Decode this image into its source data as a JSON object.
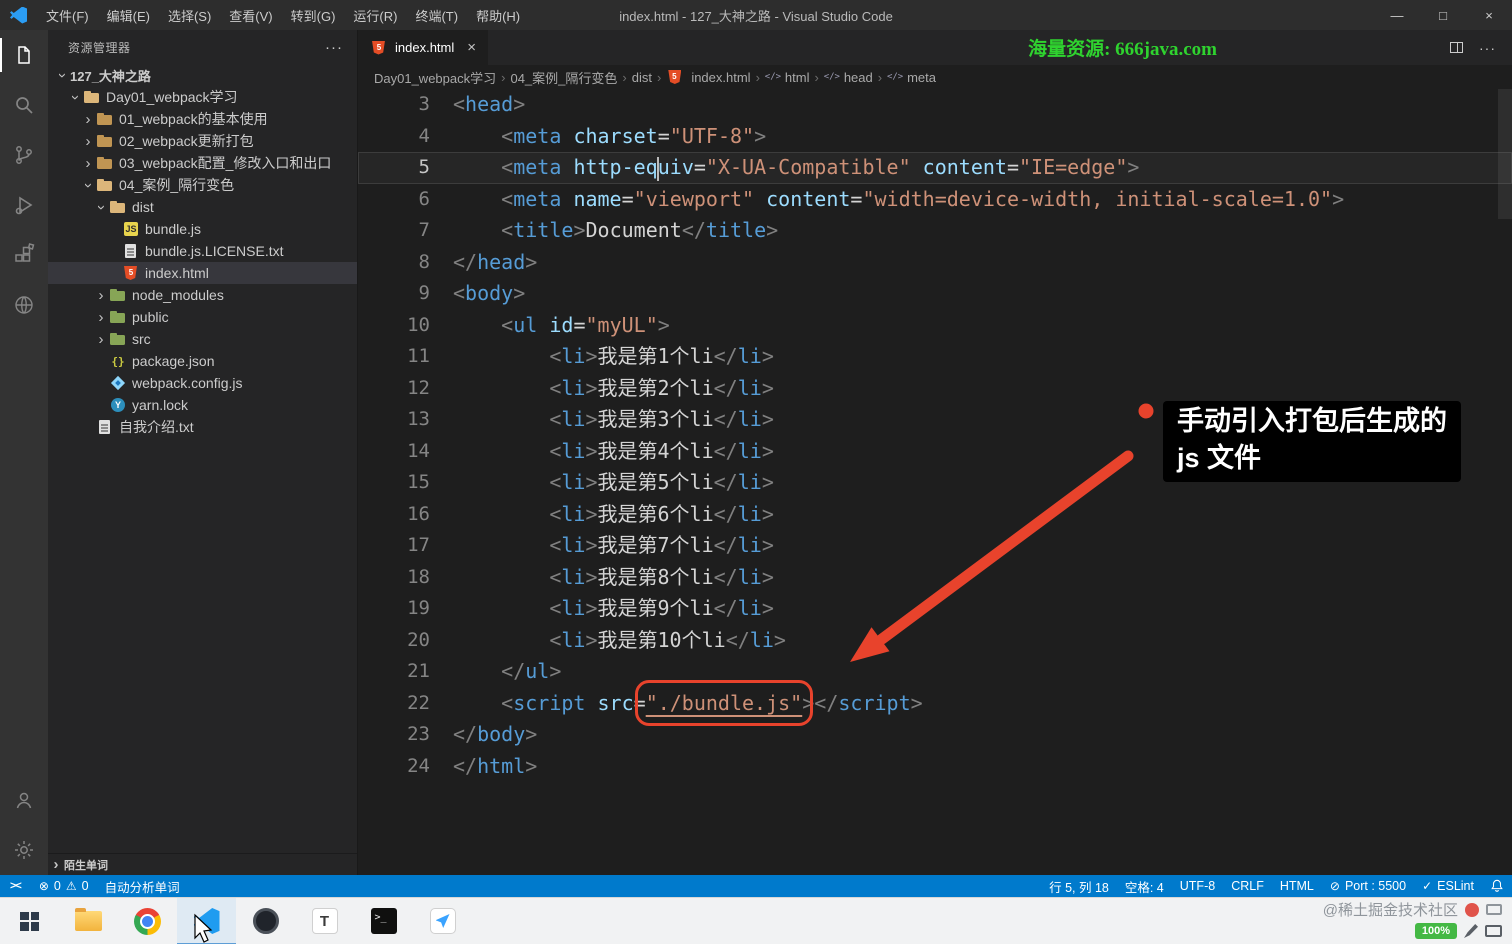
{
  "window": {
    "title": "index.html - 127_大神之路 - Visual Studio Code",
    "menus": [
      "文件(F)",
      "编辑(E)",
      "选择(S)",
      "查看(V)",
      "转到(G)",
      "运行(R)",
      "终端(T)",
      "帮助(H)"
    ],
    "controls": [
      "—",
      "□",
      "×"
    ]
  },
  "sidebar": {
    "title": "资源管理器",
    "more": "···",
    "bottom_section": "陌生单词",
    "tree": [
      {
        "label": "127_大神之路",
        "lvl": 0,
        "chev": "down"
      },
      {
        "label": "Day01_webpack学习",
        "lvl": 1,
        "chev": "down",
        "icon": "folder-open"
      },
      {
        "label": "01_webpack的基本使用",
        "lvl": 2,
        "chev": "right",
        "icon": "folder"
      },
      {
        "label": "02_webpack更新打包",
        "lvl": 2,
        "chev": "right",
        "icon": "folder"
      },
      {
        "label": "03_webpack配置_修改入口和出口",
        "lvl": 2,
        "chev": "right",
        "icon": "folder"
      },
      {
        "label": "04_案例_隔行变色",
        "lvl": 2,
        "chev": "down",
        "icon": "folder-open"
      },
      {
        "label": "dist",
        "lvl": 3,
        "chev": "down",
        "icon": "folder-open"
      },
      {
        "label": "bundle.js",
        "lvl": 4,
        "icon": "js"
      },
      {
        "label": "bundle.js.LICENSE.txt",
        "lvl": 4,
        "icon": "txt"
      },
      {
        "label": "index.html",
        "lvl": 4,
        "icon": "html",
        "selected": true
      },
      {
        "label": "node_modules",
        "lvl": 3,
        "chev": "right",
        "icon": "folder-green"
      },
      {
        "label": "public",
        "lvl": 3,
        "chev": "right",
        "icon": "folder-green"
      },
      {
        "label": "src",
        "lvl": 3,
        "chev": "right",
        "icon": "folder-green"
      },
      {
        "label": "package.json",
        "lvl": 3,
        "icon": "json"
      },
      {
        "label": "webpack.config.js",
        "lvl": 3,
        "icon": "webpack"
      },
      {
        "label": "yarn.lock",
        "lvl": 3,
        "icon": "yarn"
      },
      {
        "label": "自我介绍.txt",
        "lvl": 2,
        "icon": "txt"
      }
    ]
  },
  "editor": {
    "tab": {
      "label": "index.html",
      "close": "×"
    },
    "promo": "海量资源: 666java.com",
    "more_dots": "···",
    "breadcrumb_sep": "›",
    "breadcrumbs": [
      {
        "label": "Day01_webpack学习"
      },
      {
        "label": "04_案例_隔行变色"
      },
      {
        "label": "dist"
      },
      {
        "label": "index.html",
        "icon": "html"
      },
      {
        "label": "html",
        "icon": "sym"
      },
      {
        "label": "head",
        "icon": "sym"
      },
      {
        "label": "meta",
        "icon": "sym"
      }
    ],
    "code": {
      "lines": [
        {
          "n": 3,
          "tok": [
            [
              "<",
              "p"
            ],
            [
              "head",
              "tag"
            ],
            [
              ">",
              "p"
            ]
          ]
        },
        {
          "n": 4,
          "tok": [
            [
              "    ",
              "txt"
            ],
            [
              "<",
              "p"
            ],
            [
              "meta",
              "tag"
            ],
            [
              " ",
              "txt"
            ],
            [
              "charset",
              "attr"
            ],
            [
              "=",
              "txt"
            ],
            [
              "\"UTF-8\"",
              "str"
            ],
            [
              ">",
              "p"
            ]
          ]
        },
        {
          "n": 5,
          "cur": true,
          "tok": [
            [
              "    ",
              "txt"
            ],
            [
              "<",
              "p"
            ],
            [
              "meta",
              "tag"
            ],
            [
              " ",
              "txt"
            ],
            [
              "http-eq",
              "attr"
            ],
            [
              "",
              "cursor"
            ],
            [
              "uiv",
              "attr"
            ],
            [
              "=",
              "txt"
            ],
            [
              "\"X-UA-Compatible\"",
              "str"
            ],
            [
              " ",
              "txt"
            ],
            [
              "content",
              "attr"
            ],
            [
              "=",
              "txt"
            ],
            [
              "\"IE=edge\"",
              "str"
            ],
            [
              ">",
              "p"
            ]
          ]
        },
        {
          "n": 6,
          "tok": [
            [
              "    ",
              "txt"
            ],
            [
              "<",
              "p"
            ],
            [
              "meta",
              "tag"
            ],
            [
              " ",
              "txt"
            ],
            [
              "name",
              "attr"
            ],
            [
              "=",
              "txt"
            ],
            [
              "\"viewport\"",
              "str"
            ],
            [
              " ",
              "txt"
            ],
            [
              "content",
              "attr"
            ],
            [
              "=",
              "txt"
            ],
            [
              "\"width=device-width, initial-scale=1.0\"",
              "str"
            ],
            [
              ">",
              "p"
            ]
          ]
        },
        {
          "n": 7,
          "tok": [
            [
              "    ",
              "txt"
            ],
            [
              "<",
              "p"
            ],
            [
              "title",
              "tag"
            ],
            [
              ">",
              "p"
            ],
            [
              "Document",
              "txt"
            ],
            [
              "</",
              "p"
            ],
            [
              "title",
              "tag"
            ],
            [
              ">",
              "p"
            ]
          ]
        },
        {
          "n": 8,
          "tok": [
            [
              "</",
              "p"
            ],
            [
              "head",
              "tag"
            ],
            [
              ">",
              "p"
            ]
          ]
        },
        {
          "n": 9,
          "tok": [
            [
              "<",
              "p"
            ],
            [
              "body",
              "tag"
            ],
            [
              ">",
              "p"
            ]
          ]
        },
        {
          "n": 10,
          "tok": [
            [
              "    ",
              "txt"
            ],
            [
              "<",
              "p"
            ],
            [
              "ul",
              "tag"
            ],
            [
              " ",
              "txt"
            ],
            [
              "id",
              "attr"
            ],
            [
              "=",
              "txt"
            ],
            [
              "\"myUL\"",
              "str"
            ],
            [
              ">",
              "p"
            ]
          ]
        },
        {
          "n": 11,
          "tok": [
            [
              "        ",
              "txt"
            ],
            [
              "<",
              "p"
            ],
            [
              "li",
              "tag"
            ],
            [
              ">",
              "p"
            ],
            [
              "我是第1个li",
              "txt"
            ],
            [
              "</",
              "p"
            ],
            [
              "li",
              "tag"
            ],
            [
              ">",
              "p"
            ]
          ]
        },
        {
          "n": 12,
          "tok": [
            [
              "        ",
              "txt"
            ],
            [
              "<",
              "p"
            ],
            [
              "li",
              "tag"
            ],
            [
              ">",
              "p"
            ],
            [
              "我是第2个li",
              "txt"
            ],
            [
              "</",
              "p"
            ],
            [
              "li",
              "tag"
            ],
            [
              ">",
              "p"
            ]
          ]
        },
        {
          "n": 13,
          "tok": [
            [
              "        ",
              "txt"
            ],
            [
              "<",
              "p"
            ],
            [
              "li",
              "tag"
            ],
            [
              ">",
              "p"
            ],
            [
              "我是第3个li",
              "txt"
            ],
            [
              "</",
              "p"
            ],
            [
              "li",
              "tag"
            ],
            [
              ">",
              "p"
            ]
          ]
        },
        {
          "n": 14,
          "tok": [
            [
              "        ",
              "txt"
            ],
            [
              "<",
              "p"
            ],
            [
              "li",
              "tag"
            ],
            [
              ">",
              "p"
            ],
            [
              "我是第4个li",
              "txt"
            ],
            [
              "</",
              "p"
            ],
            [
              "li",
              "tag"
            ],
            [
              ">",
              "p"
            ]
          ]
        },
        {
          "n": 15,
          "tok": [
            [
              "        ",
              "txt"
            ],
            [
              "<",
              "p"
            ],
            [
              "li",
              "tag"
            ],
            [
              ">",
              "p"
            ],
            [
              "我是第5个li",
              "txt"
            ],
            [
              "</",
              "p"
            ],
            [
              "li",
              "tag"
            ],
            [
              ">",
              "p"
            ]
          ]
        },
        {
          "n": 16,
          "tok": [
            [
              "        ",
              "txt"
            ],
            [
              "<",
              "p"
            ],
            [
              "li",
              "tag"
            ],
            [
              ">",
              "p"
            ],
            [
              "我是第6个li",
              "txt"
            ],
            [
              "</",
              "p"
            ],
            [
              "li",
              "tag"
            ],
            [
              ">",
              "p"
            ]
          ]
        },
        {
          "n": 17,
          "tok": [
            [
              "        ",
              "txt"
            ],
            [
              "<",
              "p"
            ],
            [
              "li",
              "tag"
            ],
            [
              ">",
              "p"
            ],
            [
              "我是第7个li",
              "txt"
            ],
            [
              "</",
              "p"
            ],
            [
              "li",
              "tag"
            ],
            [
              ">",
              "p"
            ]
          ]
        },
        {
          "n": 18,
          "tok": [
            [
              "        ",
              "txt"
            ],
            [
              "<",
              "p"
            ],
            [
              "li",
              "tag"
            ],
            [
              ">",
              "p"
            ],
            [
              "我是第8个li",
              "txt"
            ],
            [
              "</",
              "p"
            ],
            [
              "li",
              "tag"
            ],
            [
              ">",
              "p"
            ]
          ]
        },
        {
          "n": 19,
          "tok": [
            [
              "        ",
              "txt"
            ],
            [
              "<",
              "p"
            ],
            [
              "li",
              "tag"
            ],
            [
              ">",
              "p"
            ],
            [
              "我是第9个li",
              "txt"
            ],
            [
              "</",
              "p"
            ],
            [
              "li",
              "tag"
            ],
            [
              ">",
              "p"
            ]
          ]
        },
        {
          "n": 20,
          "tok": [
            [
              "        ",
              "txt"
            ],
            [
              "<",
              "p"
            ],
            [
              "li",
              "tag"
            ],
            [
              ">",
              "p"
            ],
            [
              "我是第10个li",
              "txt"
            ],
            [
              "</",
              "p"
            ],
            [
              "li",
              "tag"
            ],
            [
              ">",
              "p"
            ]
          ]
        },
        {
          "n": 21,
          "tok": [
            [
              "    ",
              "txt"
            ],
            [
              "</",
              "p"
            ],
            [
              "ul",
              "tag"
            ],
            [
              ">",
              "p"
            ]
          ]
        },
        {
          "n": 22,
          "tok": [
            [
              "    ",
              "txt"
            ],
            [
              "<",
              "p"
            ],
            [
              "script",
              "tag"
            ],
            [
              " ",
              "txt"
            ],
            [
              "src",
              "attr"
            ],
            [
              "=",
              "txt"
            ],
            [
              "\"./bundle.js\"",
              "strbox"
            ],
            [
              ">",
              "p"
            ],
            [
              "</",
              "p"
            ],
            [
              "script",
              "tag"
            ],
            [
              ">",
              "p"
            ]
          ]
        },
        {
          "n": 23,
          "tok": [
            [
              "</",
              "p"
            ],
            [
              "body",
              "tag"
            ],
            [
              ">",
              "p"
            ]
          ]
        },
        {
          "n": 24,
          "tok": [
            [
              "</",
              "p"
            ],
            [
              "html",
              "tag"
            ],
            [
              ">",
              "p"
            ]
          ]
        }
      ]
    }
  },
  "annotation": {
    "line1": "手动引入打包后生成的",
    "line2": "js 文件"
  },
  "status_bar": {
    "remote_icon": "><",
    "error_icon": "⊗",
    "errors": "0",
    "warning_icon": "⚠",
    "warnings": "0",
    "word_plugin": "自动分析单词",
    "cursor_position": "行 5, 列 18",
    "spaces": "空格: 4",
    "encoding": "UTF-8",
    "eol": "CRLF",
    "language": "HTML",
    "port_icon": "⊘",
    "port": "Port : 5500",
    "eslint_icon": "✓",
    "eslint": "ESLint"
  },
  "taskbar": {
    "watermark": "@稀土掘金技术社区",
    "battery": "100%"
  }
}
